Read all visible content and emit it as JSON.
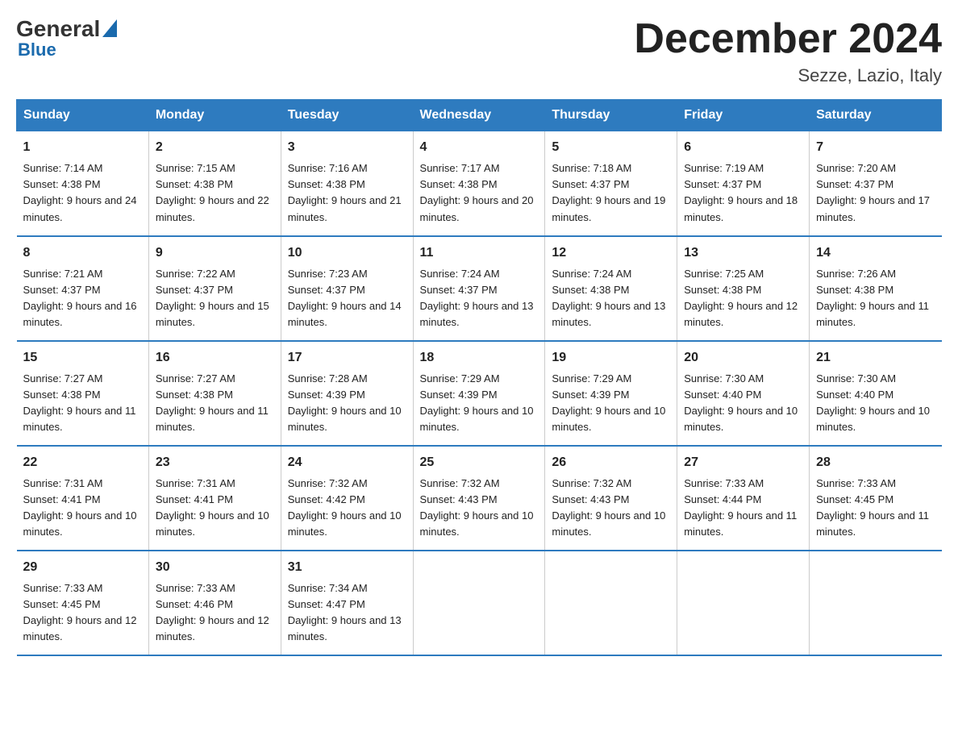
{
  "header": {
    "logo_general": "General",
    "logo_blue": "Blue",
    "title": "December 2024",
    "location": "Sezze, Lazio, Italy"
  },
  "days_of_week": [
    "Sunday",
    "Monday",
    "Tuesday",
    "Wednesday",
    "Thursday",
    "Friday",
    "Saturday"
  ],
  "weeks": [
    [
      {
        "day": "1",
        "sunrise": "Sunrise: 7:14 AM",
        "sunset": "Sunset: 4:38 PM",
        "daylight": "Daylight: 9 hours and 24 minutes."
      },
      {
        "day": "2",
        "sunrise": "Sunrise: 7:15 AM",
        "sunset": "Sunset: 4:38 PM",
        "daylight": "Daylight: 9 hours and 22 minutes."
      },
      {
        "day": "3",
        "sunrise": "Sunrise: 7:16 AM",
        "sunset": "Sunset: 4:38 PM",
        "daylight": "Daylight: 9 hours and 21 minutes."
      },
      {
        "day": "4",
        "sunrise": "Sunrise: 7:17 AM",
        "sunset": "Sunset: 4:38 PM",
        "daylight": "Daylight: 9 hours and 20 minutes."
      },
      {
        "day": "5",
        "sunrise": "Sunrise: 7:18 AM",
        "sunset": "Sunset: 4:37 PM",
        "daylight": "Daylight: 9 hours and 19 minutes."
      },
      {
        "day": "6",
        "sunrise": "Sunrise: 7:19 AM",
        "sunset": "Sunset: 4:37 PM",
        "daylight": "Daylight: 9 hours and 18 minutes."
      },
      {
        "day": "7",
        "sunrise": "Sunrise: 7:20 AM",
        "sunset": "Sunset: 4:37 PM",
        "daylight": "Daylight: 9 hours and 17 minutes."
      }
    ],
    [
      {
        "day": "8",
        "sunrise": "Sunrise: 7:21 AM",
        "sunset": "Sunset: 4:37 PM",
        "daylight": "Daylight: 9 hours and 16 minutes."
      },
      {
        "day": "9",
        "sunrise": "Sunrise: 7:22 AM",
        "sunset": "Sunset: 4:37 PM",
        "daylight": "Daylight: 9 hours and 15 minutes."
      },
      {
        "day": "10",
        "sunrise": "Sunrise: 7:23 AM",
        "sunset": "Sunset: 4:37 PM",
        "daylight": "Daylight: 9 hours and 14 minutes."
      },
      {
        "day": "11",
        "sunrise": "Sunrise: 7:24 AM",
        "sunset": "Sunset: 4:37 PM",
        "daylight": "Daylight: 9 hours and 13 minutes."
      },
      {
        "day": "12",
        "sunrise": "Sunrise: 7:24 AM",
        "sunset": "Sunset: 4:38 PM",
        "daylight": "Daylight: 9 hours and 13 minutes."
      },
      {
        "day": "13",
        "sunrise": "Sunrise: 7:25 AM",
        "sunset": "Sunset: 4:38 PM",
        "daylight": "Daylight: 9 hours and 12 minutes."
      },
      {
        "day": "14",
        "sunrise": "Sunrise: 7:26 AM",
        "sunset": "Sunset: 4:38 PM",
        "daylight": "Daylight: 9 hours and 11 minutes."
      }
    ],
    [
      {
        "day": "15",
        "sunrise": "Sunrise: 7:27 AM",
        "sunset": "Sunset: 4:38 PM",
        "daylight": "Daylight: 9 hours and 11 minutes."
      },
      {
        "day": "16",
        "sunrise": "Sunrise: 7:27 AM",
        "sunset": "Sunset: 4:38 PM",
        "daylight": "Daylight: 9 hours and 11 minutes."
      },
      {
        "day": "17",
        "sunrise": "Sunrise: 7:28 AM",
        "sunset": "Sunset: 4:39 PM",
        "daylight": "Daylight: 9 hours and 10 minutes."
      },
      {
        "day": "18",
        "sunrise": "Sunrise: 7:29 AM",
        "sunset": "Sunset: 4:39 PM",
        "daylight": "Daylight: 9 hours and 10 minutes."
      },
      {
        "day": "19",
        "sunrise": "Sunrise: 7:29 AM",
        "sunset": "Sunset: 4:39 PM",
        "daylight": "Daylight: 9 hours and 10 minutes."
      },
      {
        "day": "20",
        "sunrise": "Sunrise: 7:30 AM",
        "sunset": "Sunset: 4:40 PM",
        "daylight": "Daylight: 9 hours and 10 minutes."
      },
      {
        "day": "21",
        "sunrise": "Sunrise: 7:30 AM",
        "sunset": "Sunset: 4:40 PM",
        "daylight": "Daylight: 9 hours and 10 minutes."
      }
    ],
    [
      {
        "day": "22",
        "sunrise": "Sunrise: 7:31 AM",
        "sunset": "Sunset: 4:41 PM",
        "daylight": "Daylight: 9 hours and 10 minutes."
      },
      {
        "day": "23",
        "sunrise": "Sunrise: 7:31 AM",
        "sunset": "Sunset: 4:41 PM",
        "daylight": "Daylight: 9 hours and 10 minutes."
      },
      {
        "day": "24",
        "sunrise": "Sunrise: 7:32 AM",
        "sunset": "Sunset: 4:42 PM",
        "daylight": "Daylight: 9 hours and 10 minutes."
      },
      {
        "day": "25",
        "sunrise": "Sunrise: 7:32 AM",
        "sunset": "Sunset: 4:43 PM",
        "daylight": "Daylight: 9 hours and 10 minutes."
      },
      {
        "day": "26",
        "sunrise": "Sunrise: 7:32 AM",
        "sunset": "Sunset: 4:43 PM",
        "daylight": "Daylight: 9 hours and 10 minutes."
      },
      {
        "day": "27",
        "sunrise": "Sunrise: 7:33 AM",
        "sunset": "Sunset: 4:44 PM",
        "daylight": "Daylight: 9 hours and 11 minutes."
      },
      {
        "day": "28",
        "sunrise": "Sunrise: 7:33 AM",
        "sunset": "Sunset: 4:45 PM",
        "daylight": "Daylight: 9 hours and 11 minutes."
      }
    ],
    [
      {
        "day": "29",
        "sunrise": "Sunrise: 7:33 AM",
        "sunset": "Sunset: 4:45 PM",
        "daylight": "Daylight: 9 hours and 12 minutes."
      },
      {
        "day": "30",
        "sunrise": "Sunrise: 7:33 AM",
        "sunset": "Sunset: 4:46 PM",
        "daylight": "Daylight: 9 hours and 12 minutes."
      },
      {
        "day": "31",
        "sunrise": "Sunrise: 7:34 AM",
        "sunset": "Sunset: 4:47 PM",
        "daylight": "Daylight: 9 hours and 13 minutes."
      },
      null,
      null,
      null,
      null
    ]
  ]
}
